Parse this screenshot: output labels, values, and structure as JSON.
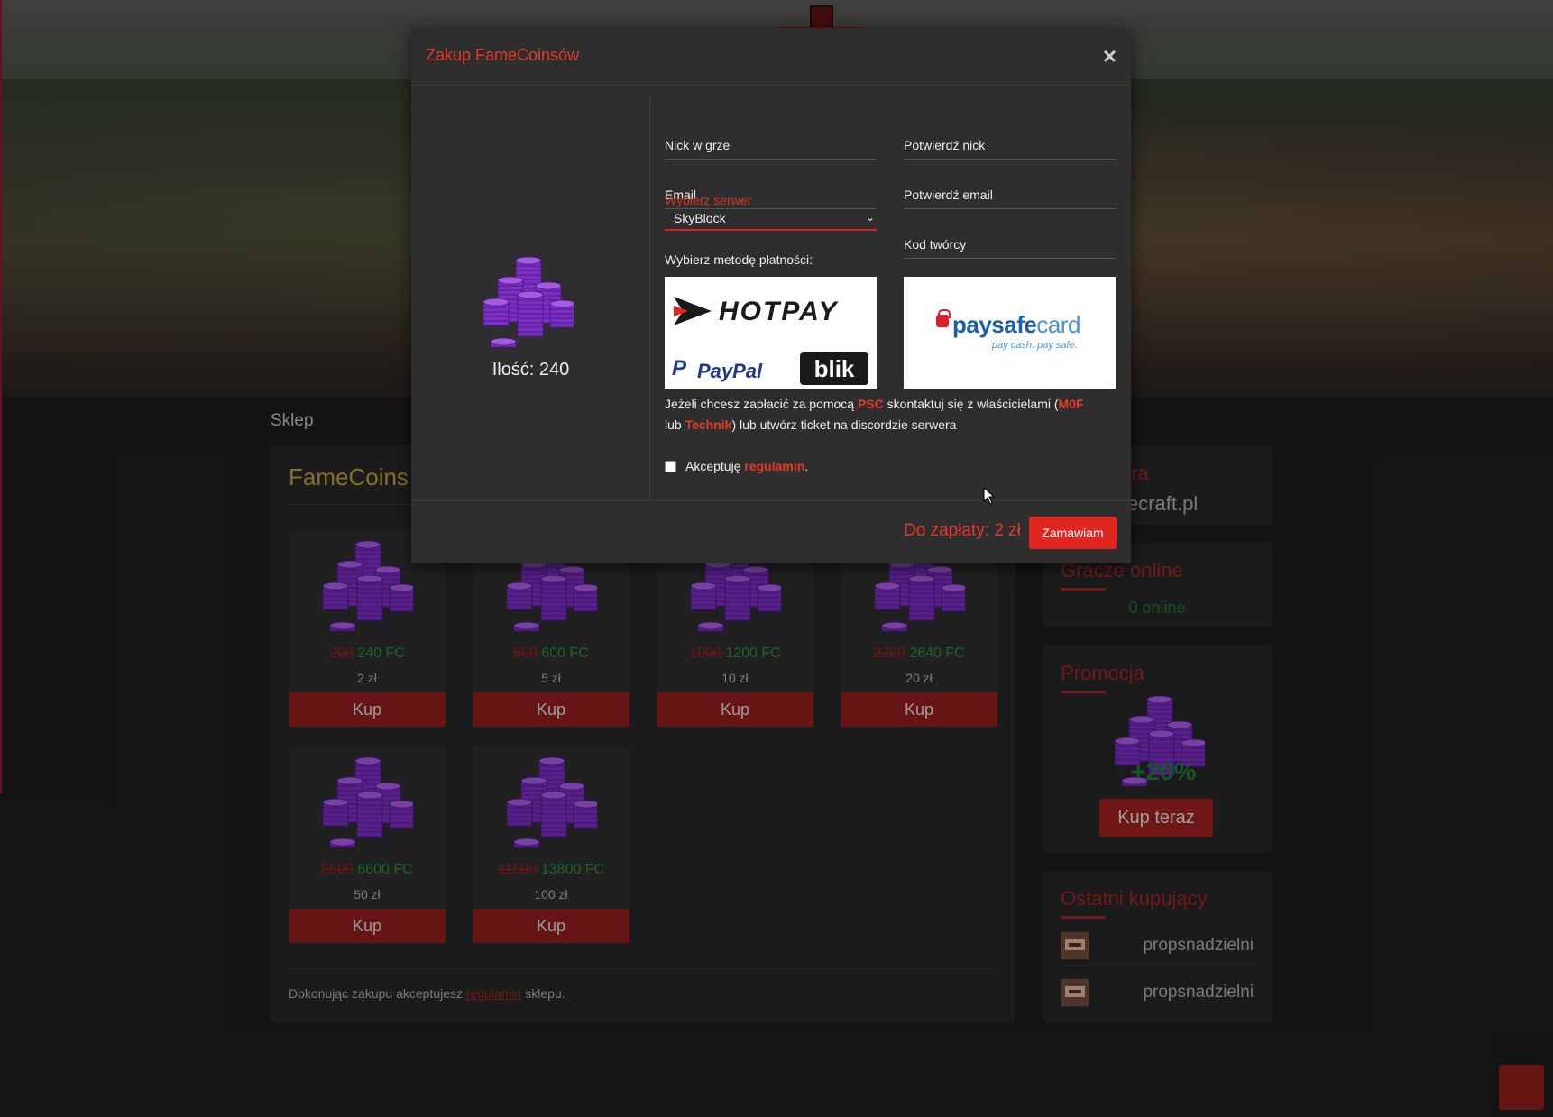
{
  "shop": {
    "heading": "Sklep",
    "title": "FameCoins",
    "products": [
      {
        "old": "200",
        "new": "240 FC",
        "price": "2 zł",
        "button": "Kup"
      },
      {
        "old": "500",
        "new": "600 FC",
        "price": "5 zł",
        "button": "Kup"
      },
      {
        "old": "1000",
        "new": "1200 FC",
        "price": "10 zł",
        "button": "Kup"
      },
      {
        "old": "2200",
        "new": "2640 FC",
        "price": "20 zł",
        "button": "Kup"
      },
      {
        "old": "5500",
        "new": "6600 FC",
        "price": "50 zł",
        "button": "Kup"
      },
      {
        "old": "11500",
        "new": "13800 FC",
        "price": "100 zł",
        "button": "Kup"
      }
    ],
    "footer_prefix": "Dokonując zakupu akceptujesz ",
    "footer_link": "regulamin",
    "footer_suffix": " sklepu."
  },
  "sidebar": {
    "server_title_partial": "era",
    "server_host_partial": "ecraft.pl",
    "online_title_partial": "Gracze online",
    "online_count": "0 online",
    "promo_title": "Promocja",
    "promo_percent": "+20%",
    "promo_button": "Kup teraz",
    "recent_title": "Ostatni kupujący",
    "recent_buyers": [
      "propsnadzielni",
      "propsnadzielni"
    ]
  },
  "modal": {
    "title": "Zakup FameCoinsów",
    "close": "×",
    "quantity": "Ilość: 240",
    "fields": {
      "nick": "Nick w grze",
      "confirm_nick": "Potwierdź nick",
      "email": "Email",
      "confirm_email": "Potwierdź email",
      "server_label": "Wybierz serwer",
      "server_value": "SkyBlock",
      "creator_code": "Kod twórcy"
    },
    "payment_label": "Wybierz metodę płatności:",
    "payment_methods": {
      "hotpay": "HOTPAY",
      "paypal": "PayPal",
      "blik": "blik",
      "paysafe_main": "paysafe",
      "paysafe_card": "card",
      "paysafe_tag": "pay cash. pay safe."
    },
    "info": {
      "p1": "Jeżeli chcesz zapłacić za pomocą ",
      "psc": "PSC",
      "p2": " skontaktuj się z właścicielami (",
      "owner1": "M0F",
      "p3": "lub ",
      "owner2": "Technik",
      "p4": ") lub utwórz ticket na discordzie serwera"
    },
    "accept_prefix": "Akceptuję ",
    "accept_link": "regulamin",
    "accept_suffix": ".",
    "total": "Do zapłaty: 2 zł",
    "order_button": "Zamawiam"
  },
  "colors": {
    "accent": "#e0261f",
    "shop_title": "#b79e38",
    "coin_purple": "#7a2fbf",
    "price_green": "#2a8a3a"
  }
}
